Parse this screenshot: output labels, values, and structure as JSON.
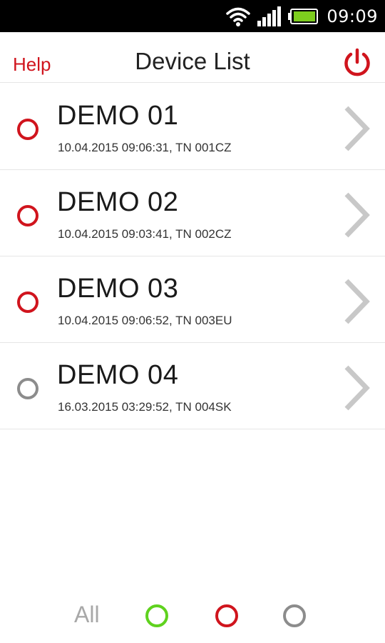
{
  "status_bar": {
    "time": "09:09",
    "icons": [
      "wifi-icon",
      "signal-icon",
      "battery-icon"
    ]
  },
  "header": {
    "help_label": "Help",
    "title": "Device List",
    "power_icon": "power-icon"
  },
  "devices": [
    {
      "name": "DEMO 01",
      "meta": "10.04.2015 09:06:31, TN 001CZ",
      "status": "red"
    },
    {
      "name": "DEMO 02",
      "meta": "10.04.2015 09:03:41, TN 002CZ",
      "status": "red"
    },
    {
      "name": "DEMO 03",
      "meta": "10.04.2015 09:06:52, TN 003EU",
      "status": "red"
    },
    {
      "name": "DEMO 04",
      "meta": "16.03.2015 03:29:52, TN 004SK",
      "status": "grey"
    }
  ],
  "filters": {
    "all_label": "All",
    "options": [
      "green",
      "red",
      "grey"
    ]
  },
  "colors": {
    "red": "#d0141d",
    "grey": "#8c8c8c",
    "green": "#5fd21e",
    "chevron": "#c8c8c8"
  }
}
